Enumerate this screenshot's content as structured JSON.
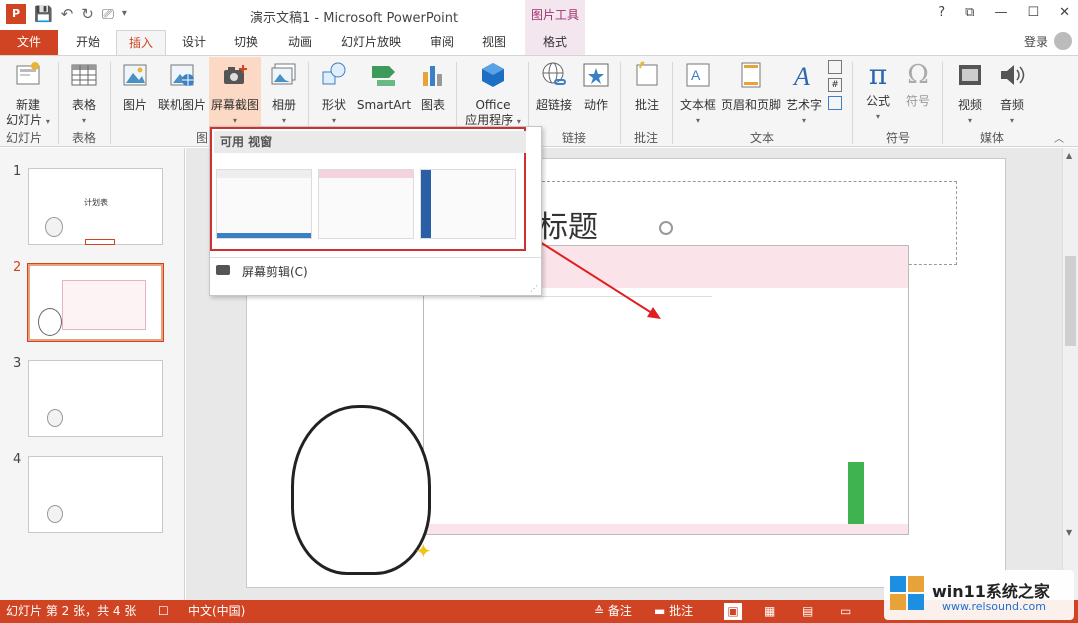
{
  "title_bar": {
    "title": "演示文稿1 - Microsoft PowerPoint",
    "picture_tools": "图片工具",
    "win_buttons": [
      "?",
      "⧉",
      "—",
      "☐",
      "✕"
    ]
  },
  "tabs": [
    "文件",
    "开始",
    "插入",
    "设计",
    "切换",
    "动画",
    "幻灯片放映",
    "审阅",
    "视图",
    "格式"
  ],
  "login": "登录",
  "ribbon": {
    "new_slide": "新建",
    "new_slide_2": "幻灯片",
    "table": "表格",
    "picture": "图片",
    "online_picture": "联机图片",
    "screenshot": "屏幕截图",
    "album": "相册",
    "shapes": "形状",
    "smartart": "SmartArt",
    "chart": "图表",
    "office_apps_1": "Office",
    "office_apps_2": "应用程序",
    "hyperlink": "超链接",
    "action": "动作",
    "comment": "批注",
    "textbox": "文本框",
    "header_footer": "页眉和页脚",
    "wordart": "艺术字",
    "formula": "公式",
    "symbol": "符号",
    "video": "视频",
    "audio": "音频",
    "groups": [
      "幻灯片",
      "表格",
      "图",
      "链接",
      "批注",
      "文本",
      "符号",
      "媒体"
    ]
  },
  "dropdown": {
    "header": "可用 视窗",
    "clip": "屏幕剪辑(C)"
  },
  "slides": [
    {
      "num": "1",
      "title": "计划表"
    },
    {
      "num": "2"
    },
    {
      "num": "3"
    },
    {
      "num": "4"
    }
  ],
  "slide_title_fragment": "标题",
  "statusbar": {
    "slide_info": "幻灯片 第 2 张，共 4 张",
    "language": "中文(中国)",
    "notes": "备注",
    "comments": "批注"
  },
  "watermark": "win11系统之家",
  "watermark_url": "www.relsound.com",
  "colors": {
    "accent": "#d04423",
    "picture_tools": "#a0306f"
  }
}
